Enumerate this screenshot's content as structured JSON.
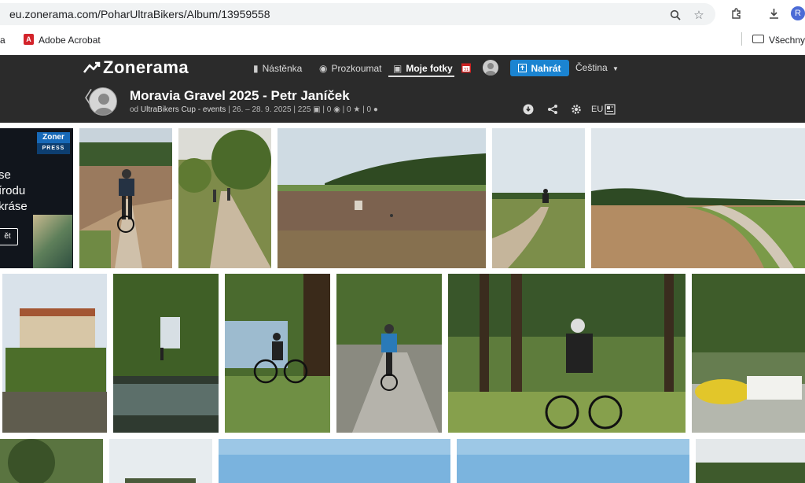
{
  "browser": {
    "url": "eu.zonerama.com/PoharUltraBikers/Album/13959558",
    "bookmarks": [
      {
        "label": "a"
      },
      {
        "label": "Adobe Acrobat"
      }
    ],
    "bookmarks_folder": "Všechny z",
    "profile_initial": "R"
  },
  "site": {
    "logo": "Zonerama",
    "nav": [
      {
        "label": "Nástěnka",
        "icon": "chart-icon"
      },
      {
        "label": "Prozkoumat",
        "icon": "compass-icon"
      },
      {
        "label": "Moje fotky",
        "icon": "photos-icon"
      }
    ],
    "calendar_badge": "31",
    "upload_label": "Nahrát",
    "language": "Čeština"
  },
  "album": {
    "title": "Moravia Gravel 2025 - Petr Janíček",
    "by_prefix": "od",
    "by": "UltraBikers Cup - events",
    "dates": "26. – 28. 9. 2025",
    "photo_count": "225",
    "views": "0",
    "likes": "0",
    "info": "0",
    "eu_label": "EU"
  },
  "ad": {
    "logo_top": "Zoner",
    "logo_bottom": "PRESS",
    "text": "se\nírodu\nkráse",
    "button": "ět"
  },
  "colors": {
    "header_bg": "#2b2b2b",
    "upload_blue": "#1b84d1"
  }
}
